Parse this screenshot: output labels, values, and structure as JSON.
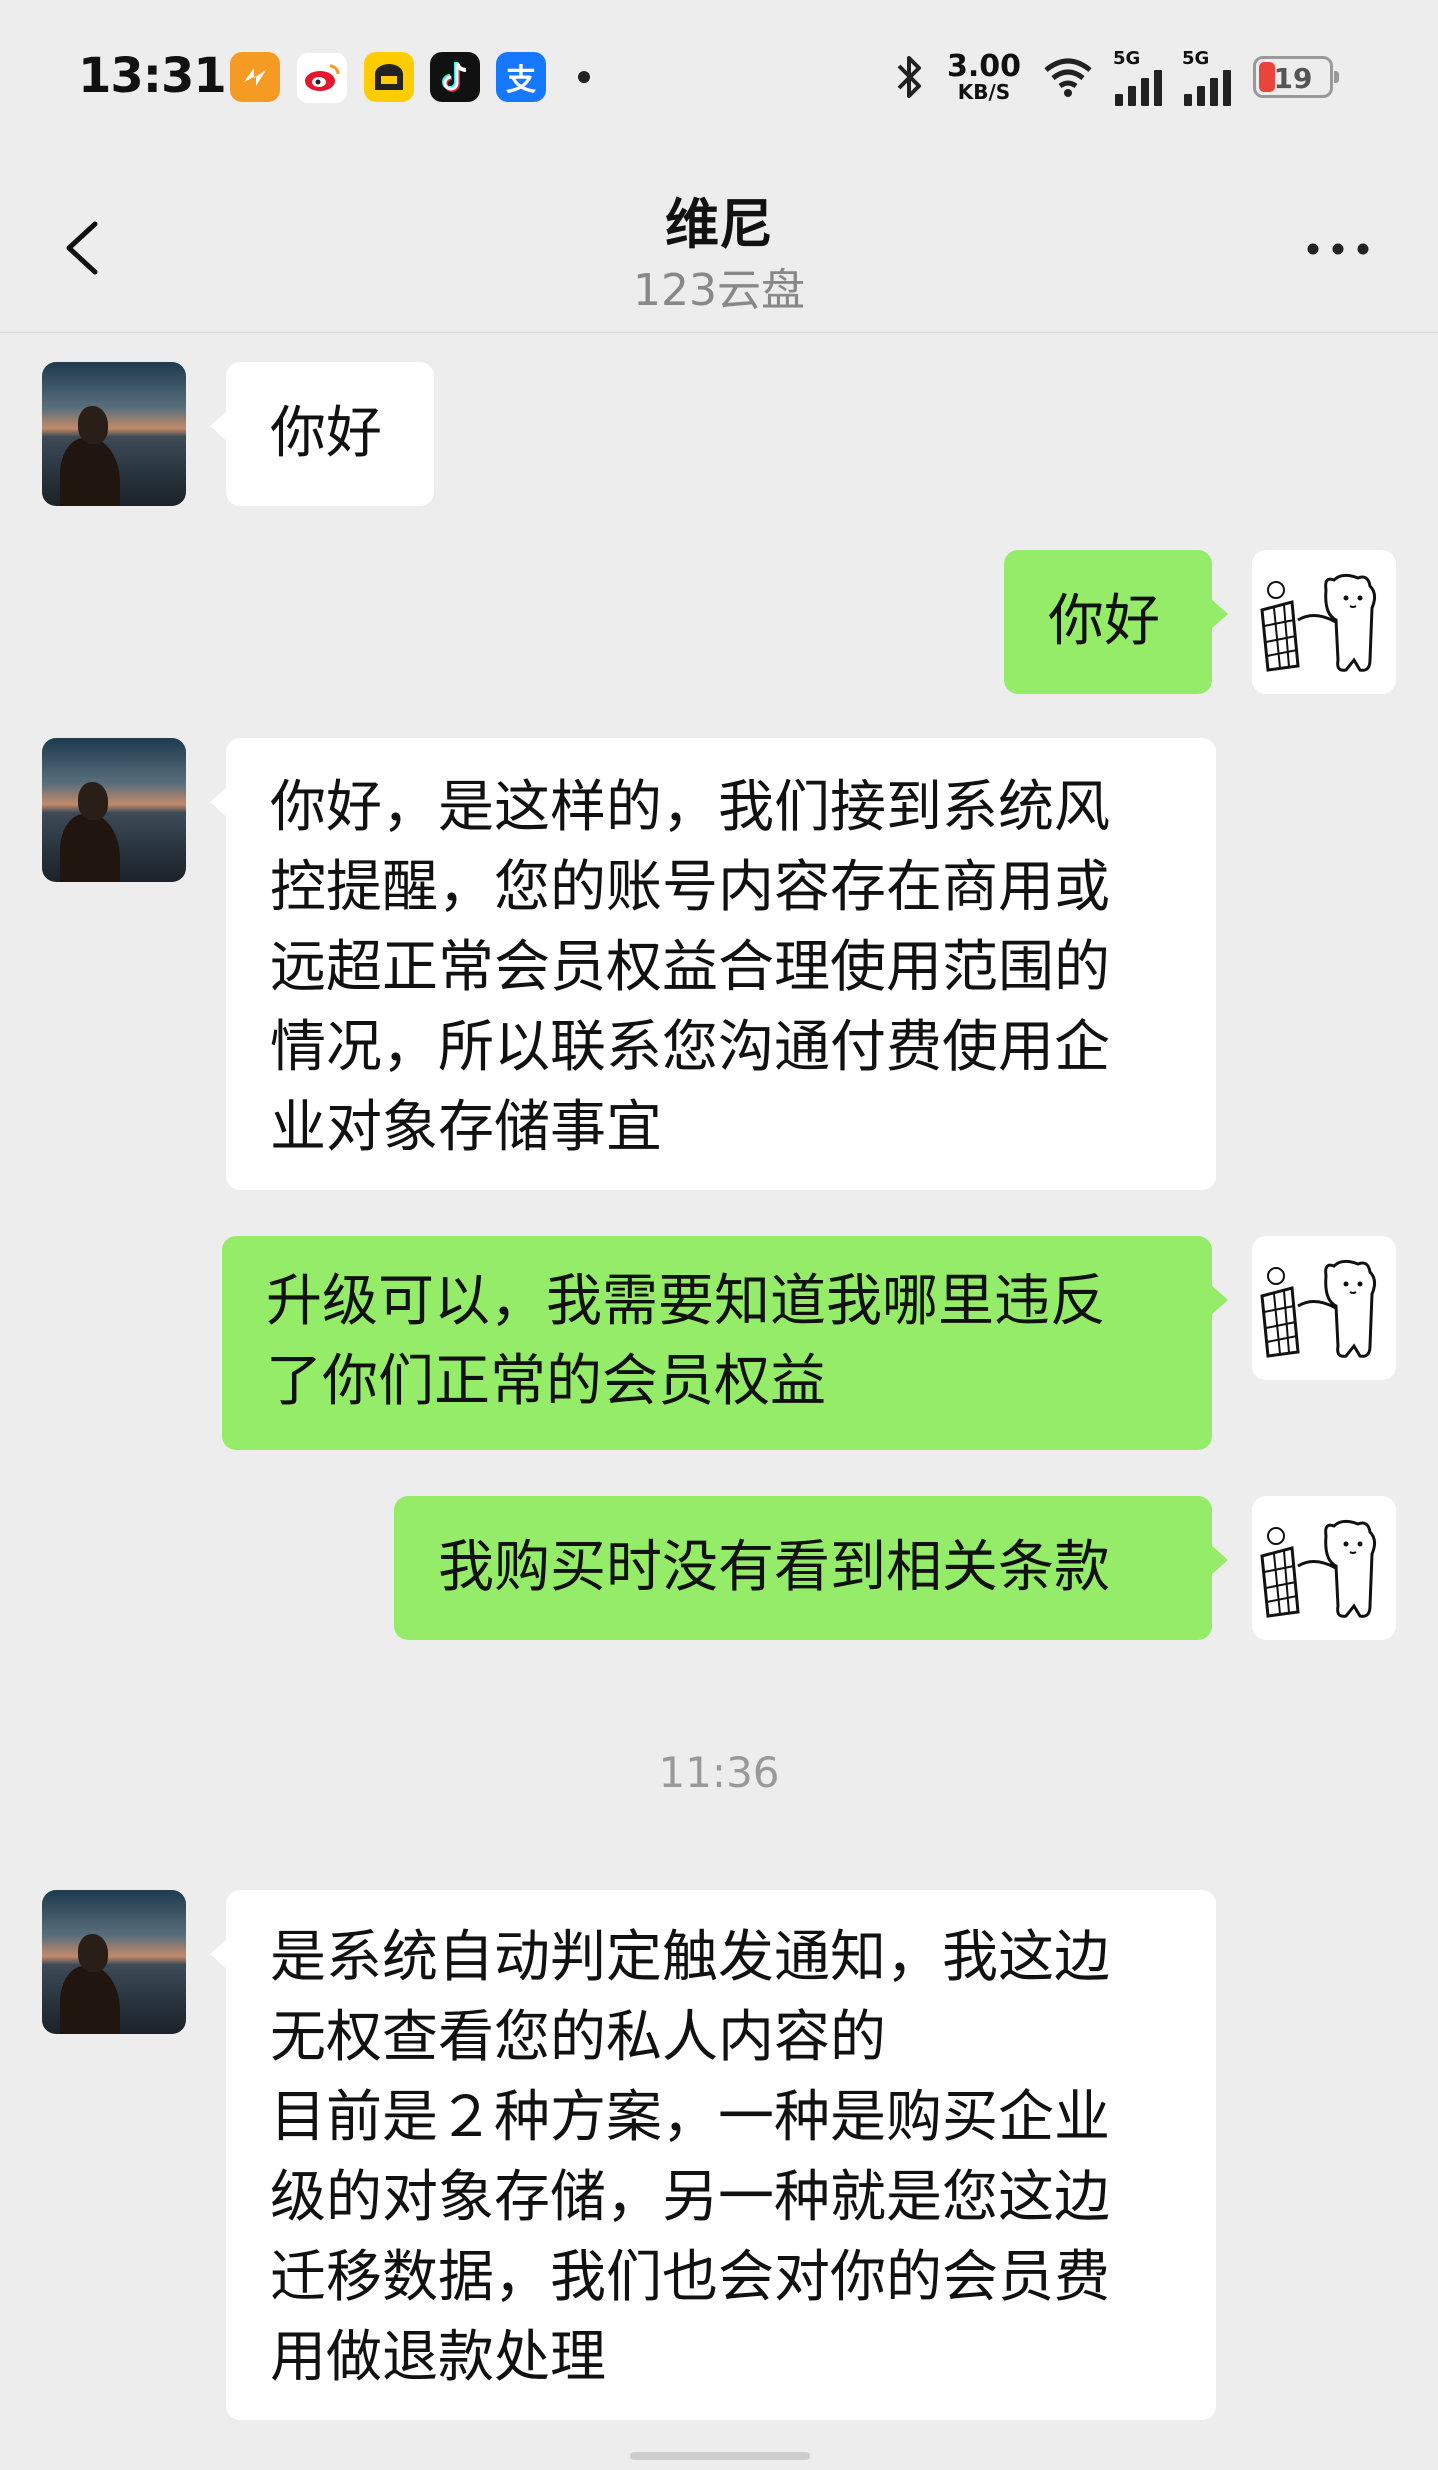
{
  "status_bar": {
    "time": "13:31",
    "net_speed_value": "3.00",
    "net_speed_unit": "KB/S",
    "signal1_label": "5G",
    "signal2_label": "5G",
    "battery": "19",
    "apps": [
      {
        "icon": "app-orange-icon",
        "color": "#f59a23"
      },
      {
        "icon": "weibo-icon",
        "color": "#e6162d"
      },
      {
        "icon": "yellow-app-icon",
        "color": "#ffcc00"
      },
      {
        "icon": "tiktok-icon",
        "color": "#111111"
      },
      {
        "icon": "alipay-icon",
        "color": "#1677ff",
        "glyph": "支"
      }
    ]
  },
  "header": {
    "title": "维尼",
    "subtitle": "123云盘"
  },
  "messages": [
    {
      "side": "left",
      "text": "你好"
    },
    {
      "side": "right",
      "text": "你好"
    },
    {
      "side": "left",
      "text": "你好，是这样的，我们接到系统风\n控提醒，您的账号内容存在商用或\n远超正常会员权益合理使用范围的\n情况，所以联系您沟通付费使用企\n业对象存储事宜"
    },
    {
      "side": "right",
      "text": "升级可以，我需要知道我哪里违反\n了你们正常的会员权益"
    },
    {
      "side": "right",
      "text": "我购买时没有看到相关条款"
    },
    {
      "side": "left",
      "text": "是系统自动判定触发通知，我这边\n无权查看您的私人内容的\n目前是２种方案，一种是购买企业\n级的对象存储，另一种就是您这边\n迁移数据，我们也会对你的会员费\n用做退款处理"
    }
  ],
  "timestamp": "11:36",
  "colors": {
    "background": "#ededed",
    "own_bubble": "#95ec69",
    "other_bubble": "#ffffff"
  }
}
